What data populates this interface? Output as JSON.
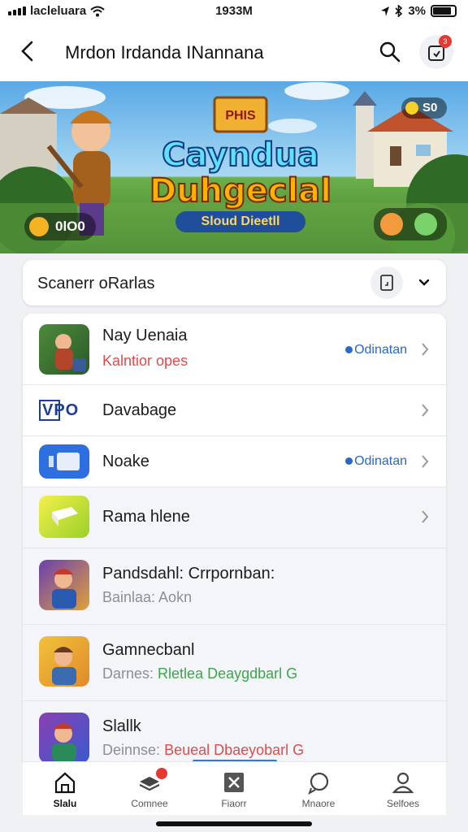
{
  "status": {
    "carrier": "lacleluara",
    "time": "1933M",
    "battery": "3%"
  },
  "appbar": {
    "title": "Mrdon Irdanda INannana"
  },
  "banner": {
    "game_title_line1": "Cayndua",
    "game_title_line2": "Duhgeclal",
    "game_subtitle": "Sloud Dieetll",
    "sign_text": "PHIS",
    "left_counter": "0lO0",
    "right_counter": "S0",
    "colors": {
      "sky": "#59a9e6",
      "grass": "#3f7d2e",
      "title_fill": "#5ee0ff",
      "title_accent": "#ffb300"
    }
  },
  "sort": {
    "label": "Scanerr oRarlas"
  },
  "list": [
    {
      "title": "Nay Uenaia",
      "subtitle": "Kalntior opes",
      "tag": "Odinatan",
      "icon": "game-hero-thumbnail"
    },
    {
      "title": "Davabage",
      "subtitle": "",
      "tag": "",
      "logo": "VPO",
      "icon": "vpo-logo"
    },
    {
      "title": "Noake",
      "subtitle": "",
      "tag": "Odinatan",
      "icon": "blue-app-icon"
    },
    {
      "title": "Rama hlene",
      "subtitle": "",
      "tag": "",
      "icon": "yellow-app-icon"
    },
    {
      "title": "Pandsdahl: Crrpornban:",
      "subtitle": "Bainlaa: Aokn",
      "icon": "game-character-thumbnail"
    },
    {
      "title": "Gamnecbanl",
      "subtitle_prefix": "Darnes:",
      "subtitle_highlight": "Rletlea Deaygdbarl G",
      "icon": "game-character-thumbnail"
    },
    {
      "title": "Slallk",
      "subtitle_prefix": "Deinnse:",
      "subtitle_highlight": "Beueal Dbaeyobarl G",
      "icon": "game-character-thumbnail"
    }
  ],
  "tabs": [
    {
      "label": "Slalu",
      "icon": "home-icon"
    },
    {
      "label": "Comnee",
      "icon": "cards-icon",
      "badge": true
    },
    {
      "label": "Fiaorr",
      "icon": "close-box-icon"
    },
    {
      "label": "Mnaore",
      "icon": "chat-icon"
    },
    {
      "label": "Selfoes",
      "icon": "profile-icon"
    }
  ]
}
